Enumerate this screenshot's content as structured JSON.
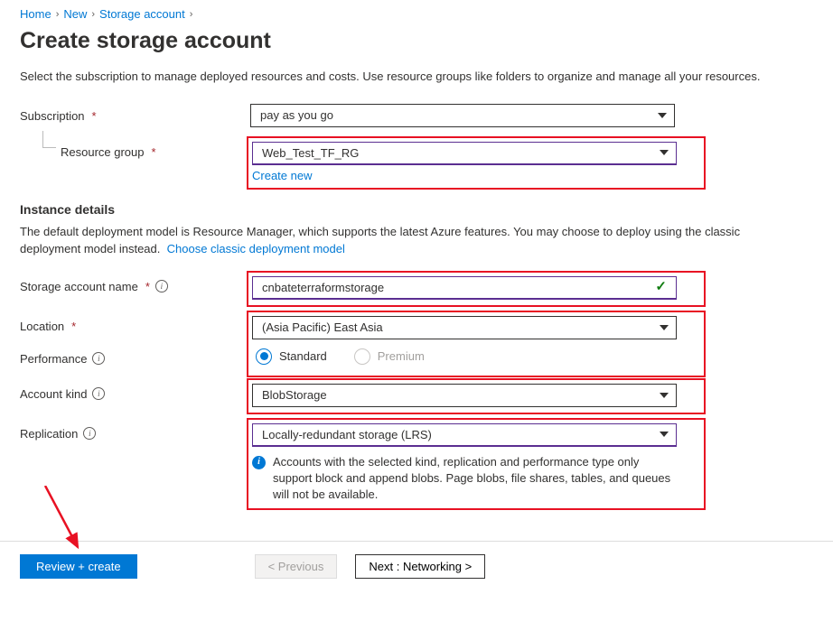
{
  "breadcrumb": {
    "home": "Home",
    "new": "New",
    "sa": "Storage account"
  },
  "title": "Create storage account",
  "intro": "Select the subscription to manage deployed resources and costs. Use resource groups like folders to organize and manage all your resources.",
  "labels": {
    "subscription": "Subscription",
    "resourceGroup": "Resource group",
    "createNew": "Create new",
    "instanceDetails": "Instance details",
    "instanceDesc": "The default deployment model is Resource Manager, which supports the latest Azure features. You may choose to deploy using the classic deployment model instead.",
    "chooseClassic": "Choose classic deployment model",
    "storageAccountName": "Storage account name",
    "location": "Location",
    "performance": "Performance",
    "accountKind": "Account kind",
    "replication": "Replication"
  },
  "values": {
    "subscription": "pay as you go",
    "resourceGroup": "Web_Test_TF_RG",
    "storageAccountName": "cnbateterraformstorage",
    "location": "(Asia Pacific) East Asia",
    "perfStandard": "Standard",
    "perfPremium": "Premium",
    "accountKind": "BlobStorage",
    "replication": "Locally-redundant storage (LRS)",
    "replicationInfo": "Accounts with the selected kind, replication and performance type only support block and append blobs. Page blobs, file shares, tables, and queues will not be available."
  },
  "footer": {
    "review": "Review + create",
    "prev": "<  Previous",
    "next": "Next : Networking  >"
  }
}
